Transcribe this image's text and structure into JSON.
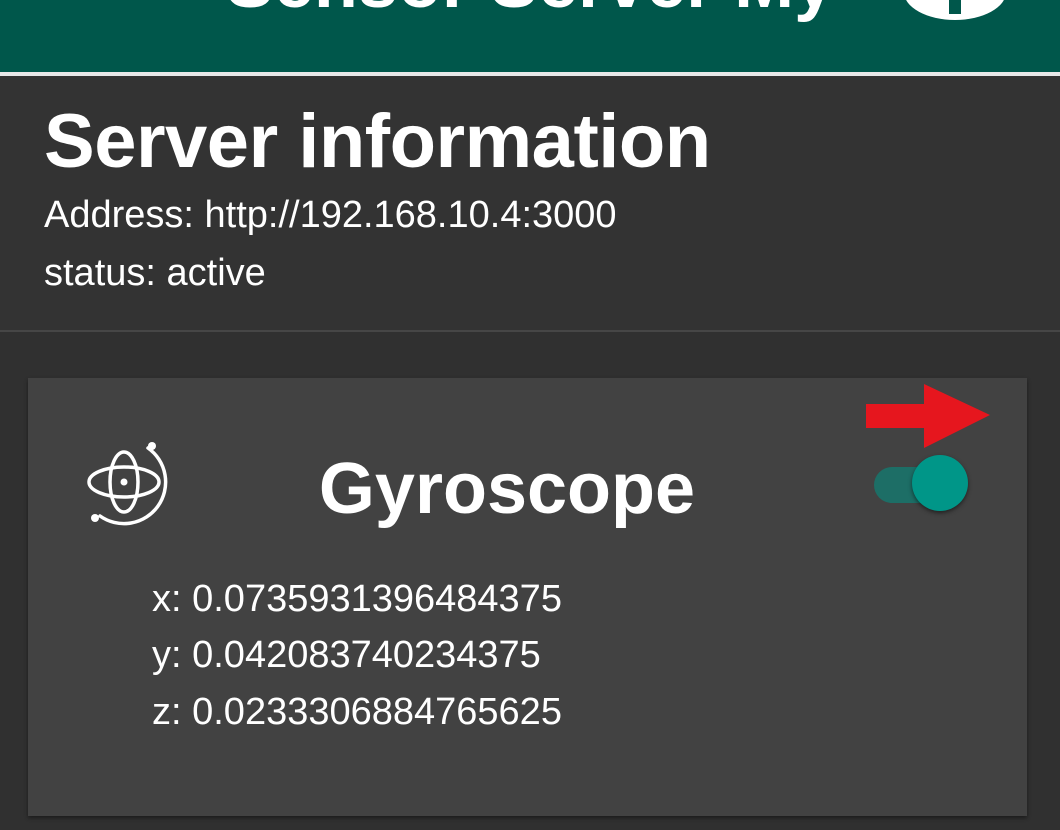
{
  "appbar": {
    "title": "Sensor Server My",
    "action_icon": "info-icon",
    "background_color": "#00574b"
  },
  "server": {
    "title": "Server information",
    "address": "Address: http://192.168.10.4:3000",
    "status": "status: active"
  },
  "gyroscope_card": {
    "icon": "gyroscope-icon",
    "title": "Gyroscope",
    "toggle_on": true,
    "accent_color": "#009688",
    "annotation_arrow_color": "#e6161e",
    "readings": {
      "x": "x: 0.0735931396484375",
      "y": "y: 0.042083740234375",
      "z": "z: 0.0233306884765625"
    }
  }
}
